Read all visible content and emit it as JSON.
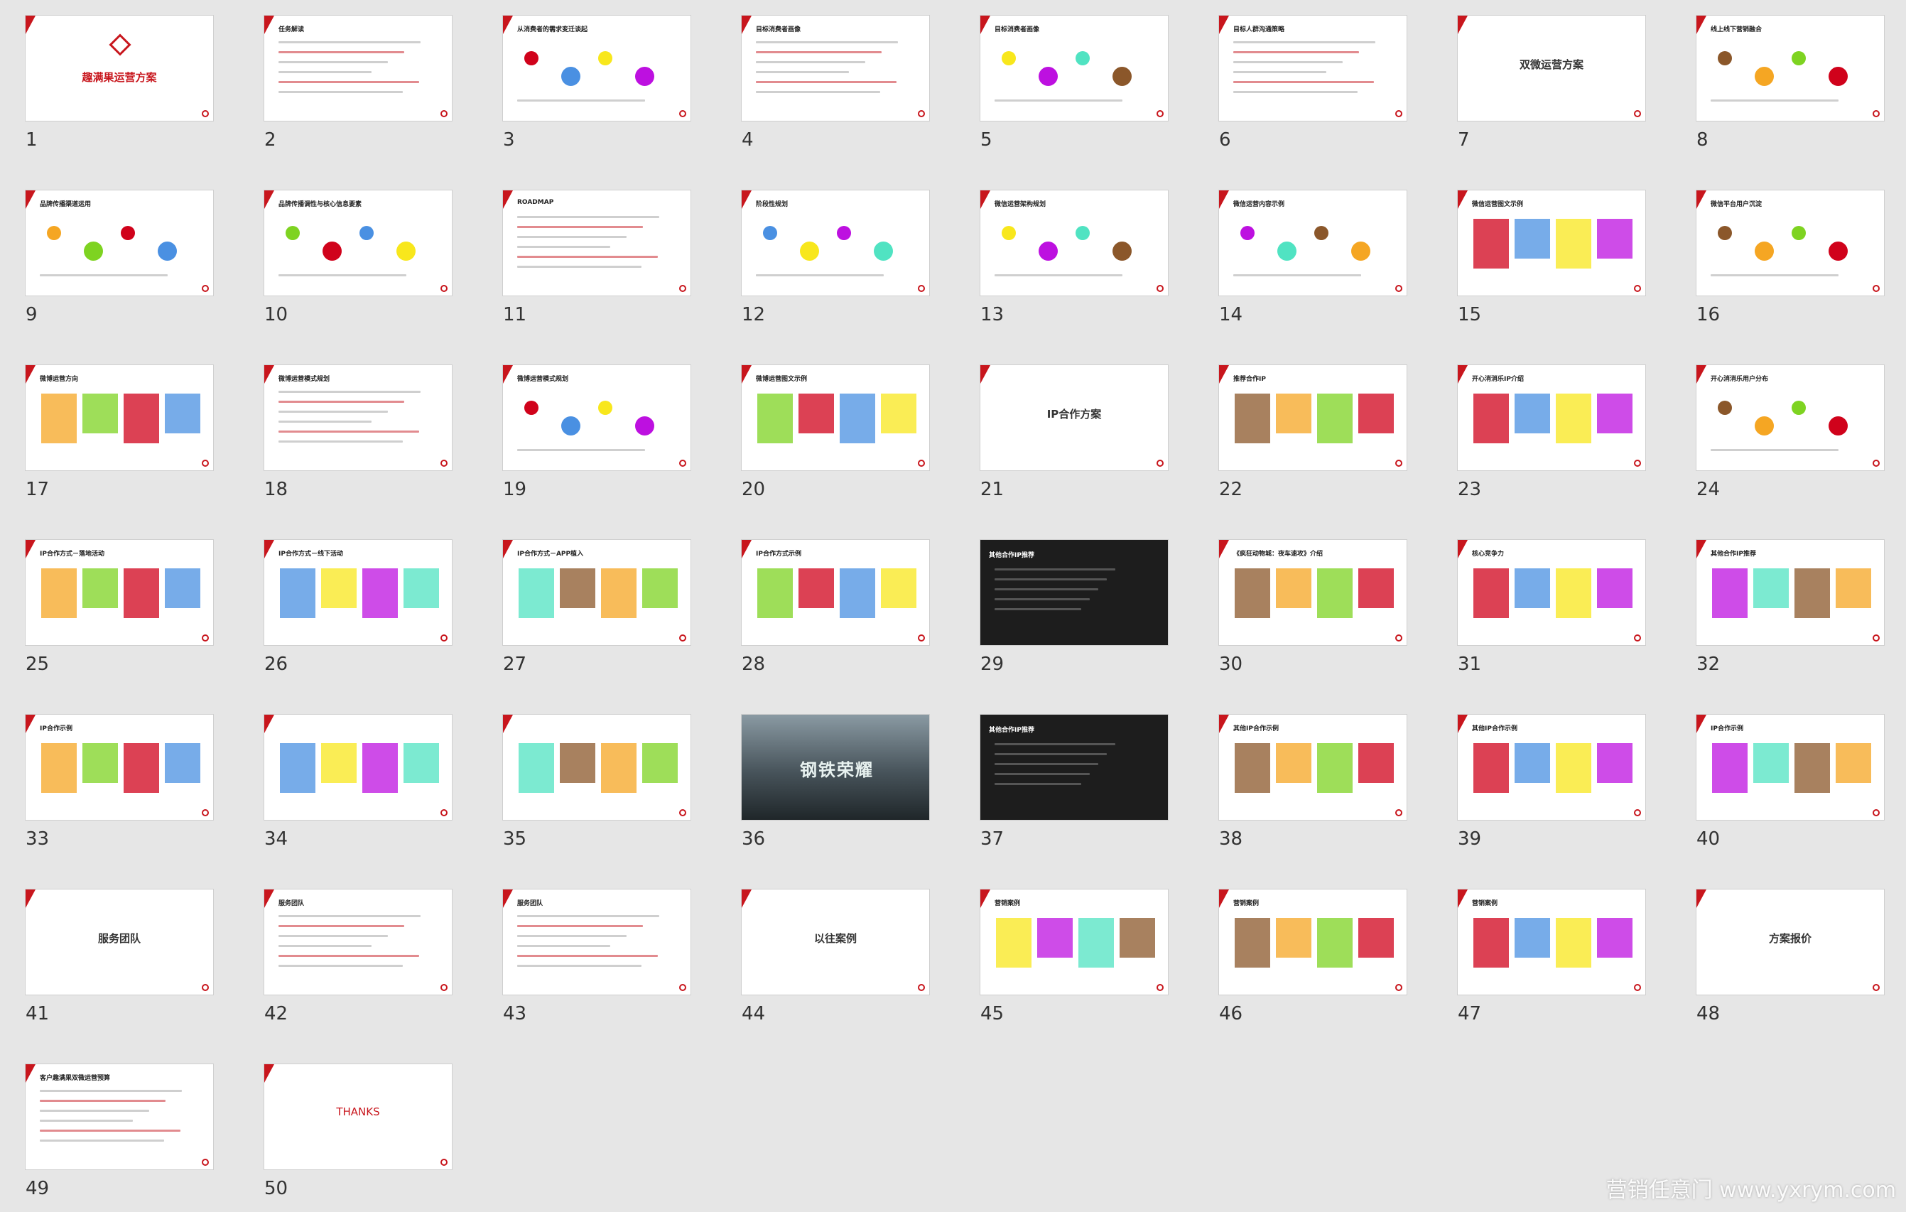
{
  "window": {
    "title": "趣满果运营方案"
  },
  "watermark": "营销任意门 www.yxrym.com",
  "colors": {
    "brand_red": "#c8161d",
    "background": "#e6e6e6",
    "slide_bg": "#ffffff"
  },
  "slides": [
    {
      "num": "1",
      "type": "cover",
      "title": "趣满果运营方案"
    },
    {
      "num": "2",
      "type": "text",
      "title": "任务解读"
    },
    {
      "num": "3",
      "type": "diagram",
      "title": "从消费者的需求变迁谈起"
    },
    {
      "num": "4",
      "type": "text",
      "title": "目标消费者画像"
    },
    {
      "num": "5",
      "type": "diagram",
      "title": "目标消费者画像"
    },
    {
      "num": "6",
      "type": "text",
      "title": "目标人群沟通策略"
    },
    {
      "num": "7",
      "type": "section",
      "title": "双微运营方案"
    },
    {
      "num": "8",
      "type": "diagram",
      "title": "线上线下营销融合"
    },
    {
      "num": "9",
      "type": "diagram",
      "title": "品牌传播渠道运用"
    },
    {
      "num": "10",
      "type": "diagram",
      "title": "品牌传播调性与核心信息要素"
    },
    {
      "num": "11",
      "type": "table",
      "title": "ROADMAP"
    },
    {
      "num": "12",
      "type": "diagram",
      "title": "阶段性规划"
    },
    {
      "num": "13",
      "type": "diagram",
      "title": "微信运营架构规划"
    },
    {
      "num": "14",
      "type": "diagram",
      "title": "微信运营内容示例"
    },
    {
      "num": "15",
      "type": "image",
      "title": "微信运营图文示例"
    },
    {
      "num": "16",
      "type": "diagram",
      "title": "微信平台用户沉淀"
    },
    {
      "num": "17",
      "type": "image",
      "title": "微博运营方向"
    },
    {
      "num": "18",
      "type": "text",
      "title": "微博运营模式规划"
    },
    {
      "num": "19",
      "type": "diagram",
      "title": "微博运营模式规划"
    },
    {
      "num": "20",
      "type": "image",
      "title": "微博运营图文示例"
    },
    {
      "num": "21",
      "type": "section",
      "title": "IP合作方案"
    },
    {
      "num": "22",
      "type": "image",
      "title": "推荐合作IP"
    },
    {
      "num": "23",
      "type": "image",
      "title": "开心消消乐IP介绍"
    },
    {
      "num": "24",
      "type": "chart",
      "title": "开心消消乐用户分布"
    },
    {
      "num": "25",
      "type": "image",
      "title": "IP合作方式－落地活动"
    },
    {
      "num": "26",
      "type": "image",
      "title": "IP合作方式－线下活动"
    },
    {
      "num": "27",
      "type": "image",
      "title": "IP合作方式－APP植入"
    },
    {
      "num": "28",
      "type": "image",
      "title": "IP合作方式示例"
    },
    {
      "num": "29",
      "type": "dark",
      "title": "其他合作IP推荐"
    },
    {
      "num": "30",
      "type": "image",
      "title": "《疯狂动物城：夜车速攻》介绍"
    },
    {
      "num": "31",
      "type": "image",
      "title": "核心竞争力"
    },
    {
      "num": "32",
      "type": "image",
      "title": "其他合作IP推荐"
    },
    {
      "num": "33",
      "type": "image",
      "title": "IP合作示例"
    },
    {
      "num": "34",
      "type": "image",
      "title": ""
    },
    {
      "num": "35",
      "type": "image",
      "title": ""
    },
    {
      "num": "36",
      "type": "photo",
      "title": "钢铁荣耀"
    },
    {
      "num": "37",
      "type": "dark",
      "title": "其他合作IP推荐"
    },
    {
      "num": "38",
      "type": "image",
      "title": "其他IP合作示例"
    },
    {
      "num": "39",
      "type": "image",
      "title": "其他IP合作示例"
    },
    {
      "num": "40",
      "type": "image",
      "title": "IP合作示例"
    },
    {
      "num": "41",
      "type": "section",
      "title": "服务团队"
    },
    {
      "num": "42",
      "type": "text",
      "title": "服务团队"
    },
    {
      "num": "43",
      "type": "text",
      "title": "服务团队"
    },
    {
      "num": "44",
      "type": "section",
      "title": "以往案例"
    },
    {
      "num": "45",
      "type": "image",
      "title": "营销案例"
    },
    {
      "num": "46",
      "type": "image",
      "title": "营销案例"
    },
    {
      "num": "47",
      "type": "image",
      "title": "营销案例"
    },
    {
      "num": "48",
      "type": "section",
      "title": "方案报价"
    },
    {
      "num": "49",
      "type": "table",
      "title": "客户趣满果双微运营预算"
    },
    {
      "num": "50",
      "type": "thanks",
      "title": "THANKS"
    }
  ]
}
